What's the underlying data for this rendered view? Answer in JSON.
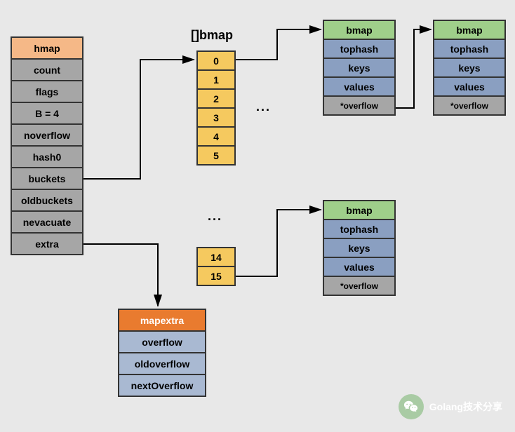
{
  "arrayTitle": "[]bmap",
  "hmap": {
    "header": "hmap",
    "fields": [
      "count",
      "flags",
      "B = 4",
      "noverflow",
      "hash0",
      "buckets",
      "oldbuckets",
      "nevacuate",
      "extra"
    ]
  },
  "array": {
    "top": [
      "0",
      "1",
      "2",
      "3",
      "4",
      "5"
    ],
    "ellipsisTop": "...",
    "ellipsisMid": "...",
    "bottom": [
      "14",
      "15"
    ]
  },
  "bmap": {
    "header": "bmap",
    "fields": [
      "tophash",
      "keys",
      "values"
    ],
    "overflow": "*overflow"
  },
  "mapextra": {
    "header": "mapextra",
    "fields": [
      "overflow",
      "oldoverflow",
      "nextOverflow"
    ]
  },
  "watermark": "Golang技术分享"
}
